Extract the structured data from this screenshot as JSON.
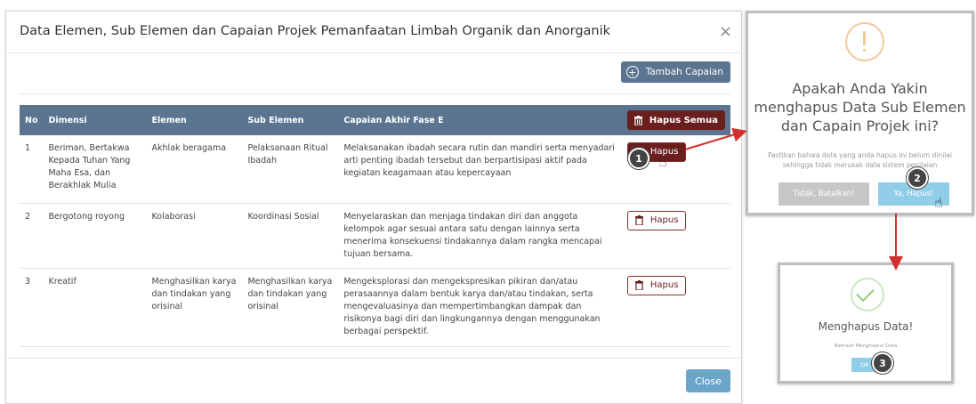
{
  "modal": {
    "title": "Data Elemen, Sub Elemen dan Capaian Projek Pemanfaatan Limbah Organik dan Anorganik",
    "close_icon": "×",
    "add_button": "Tambah Capaian",
    "close_button": "Close"
  },
  "table": {
    "headers": [
      "No",
      "Dimensi",
      "Elemen",
      "Sub Elemen",
      "Capaian Akhir Fase E"
    ],
    "delete_all": "Hapus Semua",
    "rows": [
      {
        "no": "1",
        "dimensi": "Beriman, Bertakwa Kepada Tuhan Yang Maha Esa, dan Berakhlak Mulia",
        "elemen": "Akhlak beragama",
        "sub_elemen": "Pelaksanaan Ritual Ibadah",
        "capaian": "Melaksanakan ibadah secara rutin dan mandiri serta menyadari arti penting ibadah tersebut dan berpartisipasi aktif pada kegiatan keagamaan atau kepercayaan",
        "action": "Hapus"
      },
      {
        "no": "2",
        "dimensi": "Bergotong royong",
        "elemen": "Kolaborasi",
        "sub_elemen": "Koordinasi Sosial",
        "capaian": "Menyelaraskan dan menjaga tindakan diri dan anggota kelompok agar sesuai antara satu dengan lainnya serta menerima konsekuensi tindakannya dalam rangka mencapai tujuan bersama.",
        "action": "Hapus"
      },
      {
        "no": "3",
        "dimensi": "Kreatif",
        "elemen": "Menghasilkan karya dan tindakan yang orisinal",
        "sub_elemen": "Menghasilkan karya dan tindakan yang orisinal",
        "capaian": "Mengeksplorasi dan mengekspresikan pikiran dan/atau perasaannya dalam bentuk karya dan/atau tindakan, serta mengevaluasinya dan mempertimbangkan dampak dan risikonya bagi diri dan lingkungannya dengan menggunakan berbagai perspektif.",
        "action": "Hapus"
      }
    ]
  },
  "confirm": {
    "title": "Apakah Anda Yakin menghapus Data Sub Elemen dan Capain Projek ini?",
    "text": "Pastikan bahwa data yang anda hapus ini belum dinilai sehingga tidak merusak data sistem penilaian",
    "cancel": "Tidak, Batalkan!",
    "yes": "Ya, Hapus!"
  },
  "success": {
    "title": "Menghapus Data!",
    "text": "Berhasil Menghapus Data",
    "ok": "OK"
  },
  "badges": [
    "1",
    "2",
    "3"
  ],
  "colors": {
    "header": "#5b7590",
    "danger": "#6a1f1f",
    "info": "#6ba6c9",
    "arrow": "#d32f2f"
  }
}
